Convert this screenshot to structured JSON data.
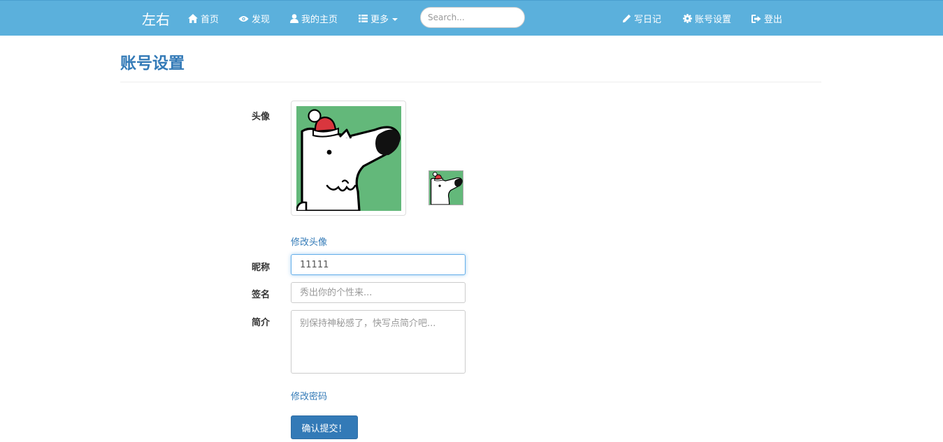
{
  "nav": {
    "brand": "左右",
    "home": "首页",
    "discover": "发现",
    "my_home": "我的主页",
    "more": "更多",
    "search_placeholder": "Search...",
    "write": "写日记",
    "settings": "账号设置",
    "logout": "登出",
    "icons": [
      "home-icon",
      "eye-icon",
      "user-icon",
      "list-icon",
      "pencil-icon",
      "gear-icon",
      "logout-icon"
    ],
    "bg_color": "#5bb0dc"
  },
  "page": {
    "title": "账号设置"
  },
  "form": {
    "avatar_label": "头像",
    "change_avatar": "修改头像",
    "nickname_label": "昵称",
    "nickname_value": "11111",
    "signature_label": "签名",
    "signature_placeholder": "秀出你的个性来...",
    "bio_label": "简介",
    "bio_placeholder": "别保持神秘感了，快写点简介吧...",
    "change_password": "修改密码",
    "submit": "确认提交！",
    "accent_color": "#337ab7"
  }
}
